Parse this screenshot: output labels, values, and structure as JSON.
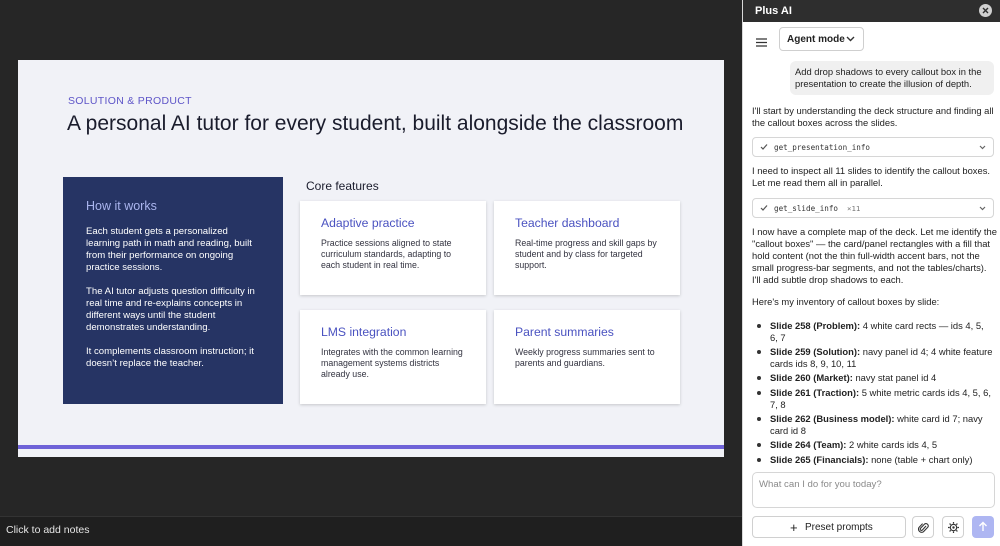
{
  "slide": {
    "eyebrow": "SOLUTION & PRODUCT",
    "title": "A personal AI tutor for every student, built alongside the classroom",
    "panel": {
      "heading": "How it works",
      "paragraphs": [
        "Each student gets a personalized learning path in math and reading, built from their performance on ongoing practice sessions.",
        "The AI tutor adjusts question difficulty in real time and re-explains concepts in different ways until the student demonstrates understanding.",
        "It complements classroom instruction; it doesn’t replace the teacher."
      ]
    },
    "core_label": "Core features",
    "cards": [
      {
        "title": "Adaptive practice",
        "body": "Practice sessions aligned to state curriculum standards, adapting to each student in real time."
      },
      {
        "title": "Teacher dashboard",
        "body": "Real-time progress and skill gaps by student and by class for targeted support."
      },
      {
        "title": "LMS integration",
        "body": "Integrates with the common learning management systems districts already use."
      },
      {
        "title": "Parent summaries",
        "body": "Weekly progress summaries sent to parents and guardians."
      }
    ],
    "colors": {
      "accent": "#6f63d8",
      "navy": "#263464",
      "card_title": "#4a52c0"
    }
  },
  "notes": {
    "placeholder": "Click to add notes"
  },
  "panel": {
    "title": "Plus AI",
    "mode_label": "Agent mode",
    "user_message": "Add drop shadows to every callout box in the presentation to create the illusion of depth.",
    "ai_msg_1": "I'll start by understanding the deck structure and finding all the callout boxes across the slides.",
    "tool_1": {
      "name": "get_presentation_info"
    },
    "ai_msg_2": "I need to inspect all 11 slides to identify the callout boxes. Let me read them all in parallel.",
    "tool_2": {
      "name": "get_slide_info",
      "count": "×11"
    },
    "ai_msg_3": "I now have a complete map of the deck. Let me identify the \"callout boxes\" — the card/panel rectangles with a fill that hold content (not the thin full-width accent bars, not the small progress-bar segments, and not the tables/charts). I'll add subtle drop shadows to each.",
    "ai_msg_4": "Here's my inventory of callout boxes by slide:",
    "inventory": [
      {
        "label": "Slide 258 (Problem):",
        "text": "4 white card rects — ids 4, 5, 6, 7"
      },
      {
        "label": "Slide 259 (Solution):",
        "text": "navy panel id 4; 4 white feature cards ids 8, 9, 10, 11"
      },
      {
        "label": "Slide 260 (Market):",
        "text": "navy stat panel id 4"
      },
      {
        "label": "Slide 261 (Traction):",
        "text": "5 white metric cards ids 4, 5, 6, 7, 8"
      },
      {
        "label": "Slide 262 (Business model):",
        "text": "white card id 7; navy card id 8"
      },
      {
        "label": "Slide 264 (Team):",
        "text": "2 white cards ids 4, 5"
      },
      {
        "label": "Slide 265 (Financials):",
        "text": "none (table + chart only)"
      }
    ],
    "input_placeholder": "What can I do for you today?",
    "preset_label": "Preset prompts"
  }
}
